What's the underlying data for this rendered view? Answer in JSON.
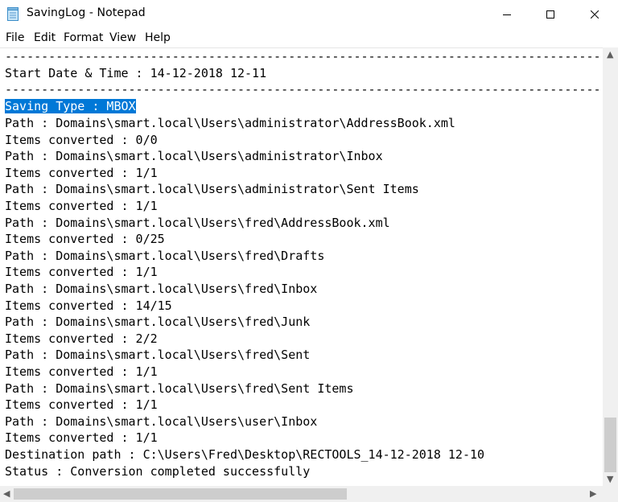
{
  "window": {
    "title": "SavingLog - Notepad"
  },
  "menu": [
    "File",
    "Edit",
    "Format",
    "View",
    "Help"
  ],
  "log": {
    "separator_top": "--------------------------------------------------------------------------------------",
    "start_line": "Start Date & Time : 14-12-2018 12-11",
    "separator": "-----------------------------------------------------------------------------------------",
    "saving_type": "Saving Type : MBOX",
    "lines": [
      "Path : Domains\\smart.local\\Users\\administrator\\AddressBook.xml",
      "Items converted : 0/0",
      "Path : Domains\\smart.local\\Users\\administrator\\Inbox",
      "Items converted : 1/1",
      "Path : Domains\\smart.local\\Users\\administrator\\Sent Items",
      "Items converted : 1/1",
      "Path : Domains\\smart.local\\Users\\fred\\AddressBook.xml",
      "Items converted : 0/25",
      "Path : Domains\\smart.local\\Users\\fred\\Drafts",
      "Items converted : 1/1",
      "Path : Domains\\smart.local\\Users\\fred\\Inbox",
      "Items converted : 14/15",
      "Path : Domains\\smart.local\\Users\\fred\\Junk",
      "Items converted : 2/2",
      "Path : Domains\\smart.local\\Users\\fred\\Sent",
      "Items converted : 1/1",
      "Path : Domains\\smart.local\\Users\\fred\\Sent Items",
      "Items converted : 1/1",
      "Path : Domains\\smart.local\\Users\\user\\Inbox",
      "Items converted : 1/1",
      "Destination path : C:\\Users\\Fred\\Desktop\\RECTOOLS_14-12-2018 12-10",
      "Status : Conversion completed successfully"
    ]
  }
}
